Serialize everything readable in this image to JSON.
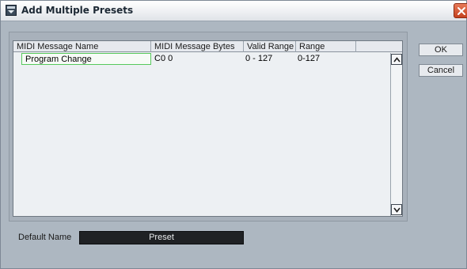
{
  "window": {
    "title": "Add Multiple Presets",
    "icon": "app-window-icon",
    "close_icon": "close-icon",
    "accent_color": "#d2532f"
  },
  "table": {
    "columns": [
      "MIDI Message Name",
      "MIDI Message Bytes",
      "Valid Range",
      "Range"
    ],
    "rows": [
      {
        "name": "Program Change",
        "bytes": "C0 0",
        "valid_range": "0 - 127",
        "range": "0-127"
      }
    ],
    "selection_color": "#57c95c",
    "scroll_up_icon": "chevron-up-icon",
    "scroll_down_icon": "chevron-down-icon"
  },
  "buttons": {
    "ok": "OK",
    "cancel": "Cancel"
  },
  "default_name": {
    "label": "Default Name",
    "value": "Preset"
  }
}
